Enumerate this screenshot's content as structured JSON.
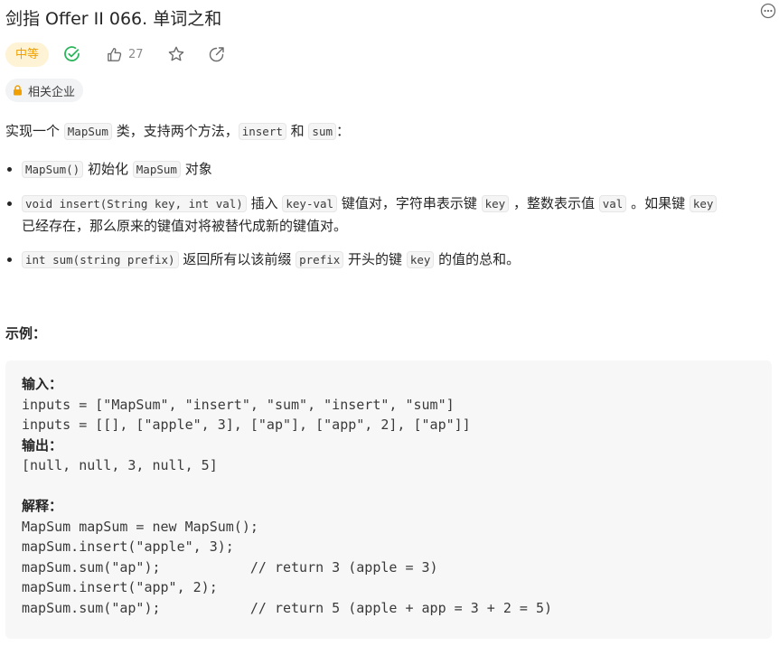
{
  "header": {
    "title": "剑指 Offer II 066. 单词之和",
    "more_icon": "more-icon"
  },
  "meta": {
    "difficulty": "中等",
    "likes": "27",
    "company_tag": "相关企业",
    "accent": "#f0a000",
    "solved_color": "#2db55d"
  },
  "description": {
    "intro_pre": "实现一个 ",
    "intro_code1": "MapSum",
    "intro_mid": " 类，支持两个方法，",
    "intro_code2": "insert",
    "intro_and": " 和 ",
    "intro_code3": "sum",
    "intro_end": "："
  },
  "bullets": {
    "b1": {
      "code1": "MapSum()",
      "t1": " 初始化 ",
      "code2": "MapSum",
      "t2": " 对象"
    },
    "b2": {
      "code1": "void insert(String key, int val)",
      "t1": " 插入 ",
      "code2": "key-val",
      "t2": " 键值对，字符串表示键 ",
      "code3": "key",
      "t3": " ，整数表示值 ",
      "code4": "val",
      "t4": " 。如果键 ",
      "code5": "key",
      "t5": "已经存在，那么原来的键值对将被替代成新的键值对。"
    },
    "b3": {
      "code1": "int sum(string prefix)",
      "t1": " 返回所有以该前缀 ",
      "code2": "prefix",
      "t2": " 开头的键 ",
      "code3": "key",
      "t3": " 的值的总和。"
    }
  },
  "example": {
    "title": "示例：",
    "input_label": "输入：",
    "input_line1": "inputs = [\"MapSum\", \"insert\", \"sum\", \"insert\", \"sum\"]",
    "input_line2": "inputs = [[], [\"apple\", 3], [\"ap\"], [\"app\", 2], [\"ap\"]]",
    "output_label": "输出：",
    "output_line": "[null, null, 3, null, 5]",
    "explain_label": "解释：",
    "explain_lines": [
      "MapSum mapSum = new MapSum();",
      "mapSum.insert(\"apple\", 3);",
      "mapSum.sum(\"ap\");           // return 3 (apple = 3)",
      "mapSum.insert(\"app\", 2);",
      "mapSum.sum(\"ap\");           // return 5 (apple + app = 3 + 2 = 5)"
    ]
  }
}
